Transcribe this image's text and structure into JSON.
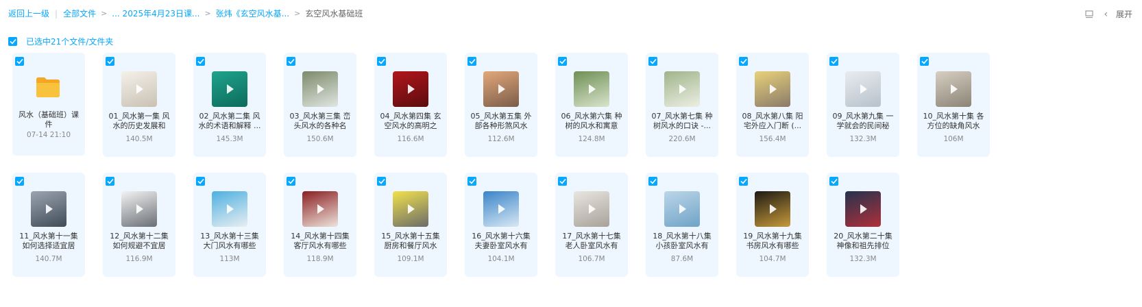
{
  "breadcrumb": {
    "back": "返回上一级",
    "all_files": "全部文件",
    "crumb1": "... 2025年4月23日课...",
    "crumb2": "张炜《玄空风水基...",
    "current": "玄空风水基础班"
  },
  "toolbar": {
    "expand_label": "展开"
  },
  "selection": {
    "text": "已选中21个文件/文件夹"
  },
  "items": [
    {
      "name": "风水（基础班）课件",
      "meta": "07-14 21:10",
      "kind": "folder",
      "colors": [
        "#f9c23c",
        "#f5a623"
      ]
    },
    {
      "name": "01_风水第一集 风水的历史发展和",
      "meta": "140.5M",
      "kind": "video",
      "colors": [
        "#f4f1ea",
        "#c9c1b3"
      ]
    },
    {
      "name": "02_风水第二集 风水的术语和解释 ...",
      "meta": "145.3M",
      "kind": "video",
      "colors": [
        "#1fa38c",
        "#0d6b5c"
      ]
    },
    {
      "name": "03_风水第三集 峦头风水的各种名",
      "meta": "150.6M",
      "kind": "video",
      "colors": [
        "#7d8a6a",
        "#dfe6e2"
      ]
    },
    {
      "name": "04_风水第四集 玄空风水的高明之",
      "meta": "116.6M",
      "kind": "video",
      "colors": [
        "#b0161c",
        "#5c0c0f"
      ]
    },
    {
      "name": "05_风水第五集 外部各种形煞风水",
      "meta": "112.6M",
      "kind": "video",
      "colors": [
        "#e3a87a",
        "#7a5c4a"
      ]
    },
    {
      "name": "06_风水第六集 种树的风水和寓意",
      "meta": "124.8M",
      "kind": "video",
      "colors": [
        "#6e8f54",
        "#d9e4cd"
      ]
    },
    {
      "name": "07_风水第七集 种树风水的口诀 -...",
      "meta": "220.6M",
      "kind": "video",
      "colors": [
        "#9fb48a",
        "#ecefe4"
      ]
    },
    {
      "name": "08_风水第八集 阳宅外应入门断 (...",
      "meta": "156.4M",
      "kind": "video",
      "colors": [
        "#e8d27a",
        "#8a7a6a"
      ]
    },
    {
      "name": "09_风水第九集 一学就会的民间秘",
      "meta": "132.3M",
      "kind": "video",
      "colors": [
        "#e9ecef",
        "#b7c1cc"
      ]
    },
    {
      "name": "10_风水第十集 各方位的缺角风水",
      "meta": "106M",
      "kind": "video",
      "colors": [
        "#d7cfc2",
        "#8c8377"
      ]
    },
    {
      "name": "11_风水第十一集 如何选择适宜居",
      "meta": "140.7M",
      "kind": "video",
      "colors": [
        "#9aa5b1",
        "#3f4b56"
      ]
    },
    {
      "name": "12_风水第十二集 如何规避不宜居",
      "meta": "116.9M",
      "kind": "video",
      "colors": [
        "#f3f3f3",
        "#6a6f75"
      ]
    },
    {
      "name": "13_风水第十三集 大门风水有哪些",
      "meta": "113M",
      "kind": "video",
      "colors": [
        "#4fb0e0",
        "#e8eef2"
      ]
    },
    {
      "name": "14_风水第十四集 客厅风水有哪些",
      "meta": "118.9M",
      "kind": "video",
      "colors": [
        "#8b1f22",
        "#ede4dc"
      ]
    },
    {
      "name": "15_风水第十五集 厨房和餐厅风水",
      "meta": "109.1M",
      "kind": "video",
      "colors": [
        "#f1e24a",
        "#6b6b6b"
      ]
    },
    {
      "name": "16_风水第十六集 夫妻卧室风水有",
      "meta": "104.1M",
      "kind": "video",
      "colors": [
        "#3a84c9",
        "#d9e8f3"
      ]
    },
    {
      "name": "17_风水第十七集 老人卧室风水有",
      "meta": "106.7M",
      "kind": "video",
      "colors": [
        "#e9e6e0",
        "#a7a199"
      ]
    },
    {
      "name": "18_风水第十八集 小孩卧室风水有",
      "meta": "87.6M",
      "kind": "video",
      "colors": [
        "#bcd6e8",
        "#6fa3c6"
      ]
    },
    {
      "name": "19_风水第十九集 书房风水有哪些",
      "meta": "104.7M",
      "kind": "video",
      "colors": [
        "#1e1a14",
        "#c79a3a"
      ]
    },
    {
      "name": "20_风水第二十集 神像和祖先排位",
      "meta": "132.3M",
      "kind": "video",
      "colors": [
        "#24324f",
        "#b0303a"
      ]
    }
  ]
}
